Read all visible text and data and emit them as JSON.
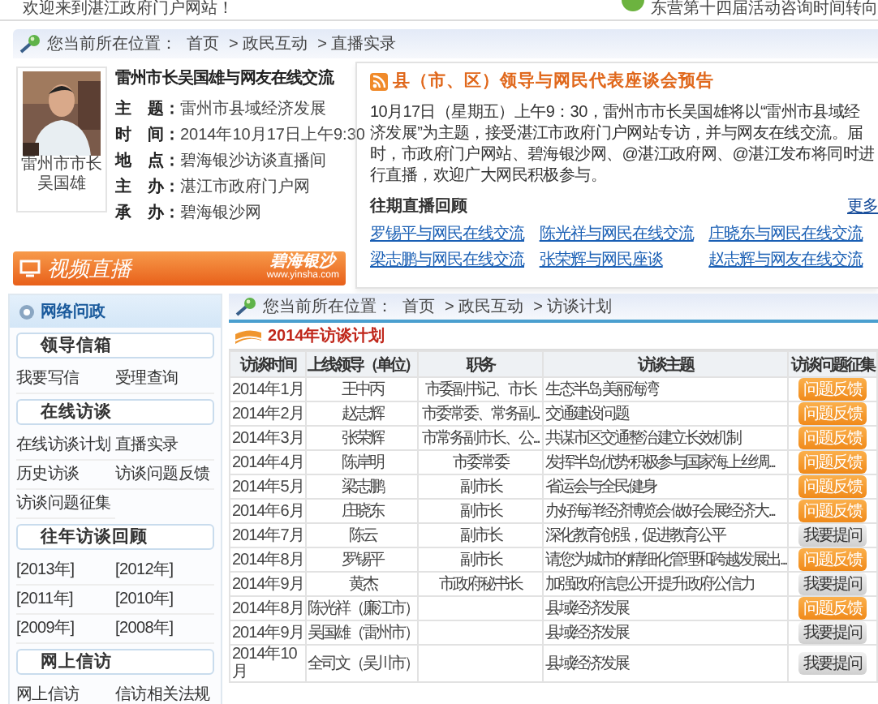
{
  "top_bar": {
    "welcome": "欢迎来到湛江政府门户网站！",
    "notice": "东营第十四届活动咨询时间转向"
  },
  "breadcrumb": {
    "label": "您当前所在位置：",
    "items": [
      "首页",
      "> 政民互动",
      "> 直播实录"
    ]
  },
  "live": {
    "title": "雷州市长吴国雄与网友在线交流",
    "caption": [
      "雷州市市长",
      "吴国雄"
    ],
    "details": [
      {
        "label": "主　题：",
        "value": "雷州市县域经济发展"
      },
      {
        "label": "时　间：",
        "value": "2014年10月17日上午9:30"
      },
      {
        "label": "地　点：",
        "value": "碧海银沙访谈直播间"
      },
      {
        "label": "主　办：",
        "value": "湛江市政府门户网"
      },
      {
        "label": "承　办：",
        "value": "碧海银沙网"
      }
    ]
  },
  "preview": {
    "title": "县（市、区）领导与网民代表座谈会预告",
    "text": "10月17日（星期五）上午9：30，雷州市市长吴国雄将以“雷州市县域经济发展”为主题，接受湛江市政府门户网站专访，并与网友在线交流。届时，市政府门户网站、碧海银沙网、@湛江政府网、@湛江发布将同时进行直播，欢迎广大网民积极参与。",
    "past_title": "往期直播回顾",
    "more": "更多",
    "links": [
      "罗锡平与网民在线交流",
      "陈光祥与网民在线交流",
      "庄晓东与网民在线交流",
      "梁志鹏与网民在线交流",
      "张荣辉与网民座谈",
      "赵志辉与网友在线交流"
    ]
  },
  "video_banner": {
    "title": "视频直播",
    "brand": "碧海银沙",
    "url": "www.yinsha.com"
  },
  "sidebar": {
    "title": "网络问政",
    "groups": [
      {
        "title": "领导信箱",
        "links": [
          "我要写信",
          "受理查询"
        ]
      },
      {
        "title": "在线访谈",
        "links": [
          "在线访谈计划",
          "直播实录",
          "历史访谈",
          "访谈问题反馈",
          "访谈问题征集"
        ]
      },
      {
        "title": "往年访谈回顾",
        "links": [
          "[2013年]",
          "[2012年]",
          "[2011年]",
          "[2010年]",
          "[2009年]",
          "[2008年]"
        ]
      },
      {
        "title": "网上信访",
        "links": [
          "网上信访",
          "信访相关法规"
        ]
      }
    ]
  },
  "plan": {
    "breadcrumb": {
      "label": "您当前所在位置：",
      "items": [
        "首页",
        "> 政民互动",
        "> 访谈计划"
      ]
    },
    "title": "2014年访谈计划",
    "columns": [
      "访谈时间",
      "上线领导（单位）",
      "职务",
      "访谈主题",
      "访谈问题征集"
    ],
    "rows": [
      {
        "time": "2014年1月",
        "leader": "王中丙",
        "duty": "市委副书记、市长",
        "topic": "生态半岛 美丽海湾",
        "action": {
          "kind": "feedback",
          "label": "问题反馈"
        }
      },
      {
        "time": "2014年2月",
        "leader": "赵志辉",
        "duty": "市委常委、常务副...",
        "topic": "交通建设问题",
        "action": {
          "kind": "feedback",
          "label": "问题反馈"
        }
      },
      {
        "time": "2014年3月",
        "leader": "张荣辉",
        "duty": "市常务副市长、公...",
        "topic": "共谋市区交通整治 建立长效机制",
        "action": {
          "kind": "feedback",
          "label": "问题反馈"
        }
      },
      {
        "time": "2014年4月",
        "leader": "陈岸明",
        "duty": "市委常委",
        "topic": "发挥半岛优势 积极参与国家海上丝绸...",
        "action": {
          "kind": "feedback",
          "label": "问题反馈"
        }
      },
      {
        "time": "2014年5月",
        "leader": "梁志鹏",
        "duty": "副市长",
        "topic": "省运会与全民健身",
        "action": {
          "kind": "feedback",
          "label": "问题反馈"
        }
      },
      {
        "time": "2014年6月",
        "leader": "庄晓东",
        "duty": "副市长",
        "topic": "办好海洋经济博览会 做好会展经济大...",
        "action": {
          "kind": "feedback",
          "label": "问题反馈"
        }
      },
      {
        "time": "2014年7月",
        "leader": "陈云",
        "duty": "副市长",
        "topic": "深化教育创强，促进教育公平",
        "action": {
          "kind": "ask",
          "label": "我要提问"
        }
      },
      {
        "time": "2014年8月",
        "leader": "罗锡平",
        "duty": "副市长",
        "topic": "请您为城市的精细化管理和跨越发展出...",
        "action": {
          "kind": "feedback",
          "label": "问题反馈"
        }
      },
      {
        "time": "2014年9月",
        "leader": "黄杰",
        "duty": "市政府秘书长",
        "topic": "加强政府信息公开 提升政府公信力",
        "action": {
          "kind": "ask",
          "label": "我要提问"
        }
      },
      {
        "time": "2014年8月",
        "leader": "陈光祥（廉江市）",
        "duty": "",
        "topic": "县域经济发展",
        "action": {
          "kind": "feedback",
          "label": "问题反馈"
        }
      },
      {
        "time": "2014年9月",
        "leader": "吴国雄（雷州市）",
        "duty": "",
        "topic": "县域经济发展",
        "action": {
          "kind": "ask",
          "label": "我要提问"
        }
      },
      {
        "time": "2014年10月",
        "leader": "全司文（吴川市）",
        "duty": "",
        "topic": "县域经济发展",
        "action": {
          "kind": "ask",
          "label": "我要提问"
        }
      }
    ]
  }
}
